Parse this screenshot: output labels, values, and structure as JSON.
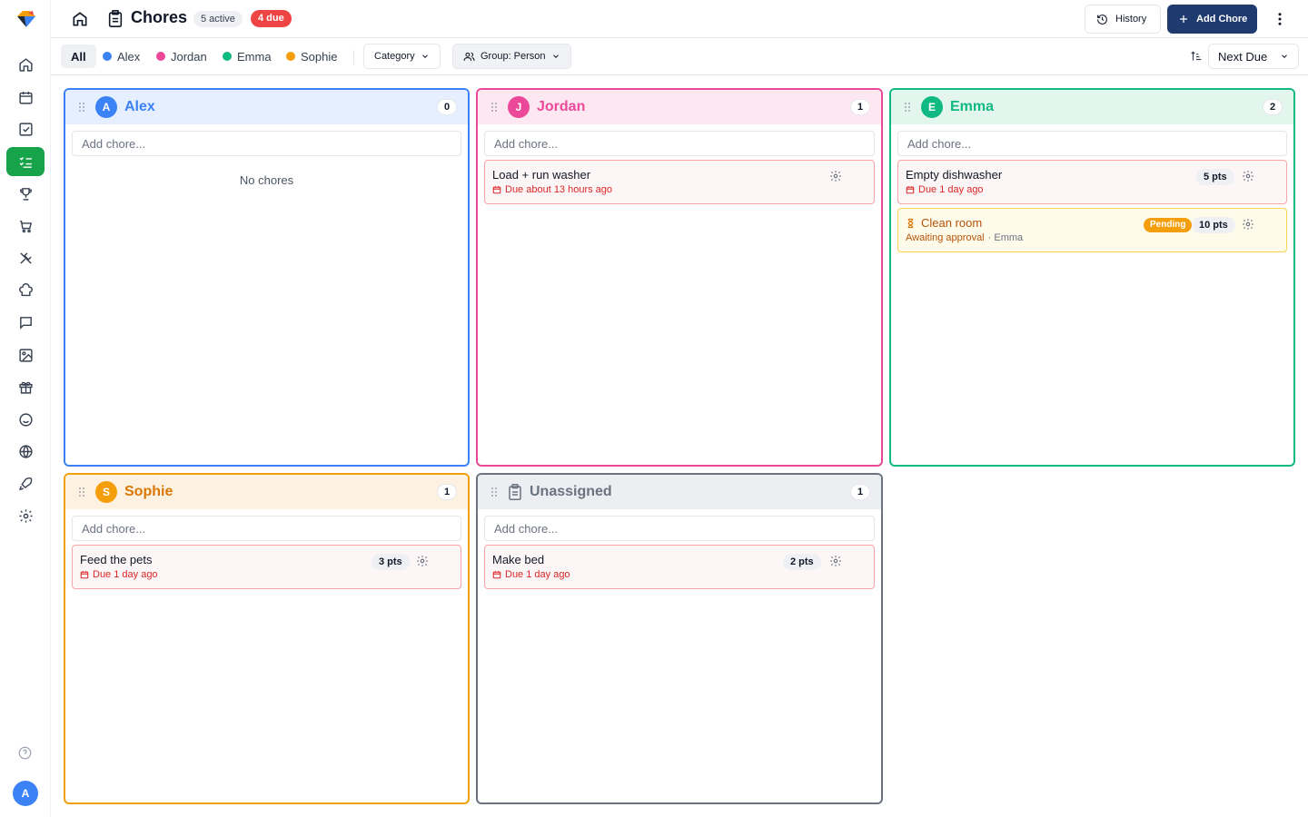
{
  "header": {
    "title": "Chores",
    "active_badge": "5 active",
    "due_badge": "4 due",
    "history_label": "History",
    "add_label": "Add Chore"
  },
  "sidebar": {
    "items": [
      "home",
      "calendar",
      "tasks",
      "chores",
      "trophy",
      "cart",
      "meals",
      "recipes",
      "chat",
      "photos",
      "gifts",
      "smile",
      "globe",
      "rocket",
      "settings"
    ],
    "active": "chores",
    "user_initial": "A"
  },
  "filters": {
    "all_label": "All",
    "people": [
      {
        "name": "Alex",
        "color": "#3b82f6"
      },
      {
        "name": "Jordan",
        "color": "#ec4899"
      },
      {
        "name": "Emma",
        "color": "#10b981"
      },
      {
        "name": "Sophie",
        "color": "#f59e0b"
      }
    ],
    "category_label": "Category",
    "group_label": "Group: Person",
    "sort_label": "Next Due"
  },
  "columns": [
    {
      "name": "Alex",
      "initial": "A",
      "color": "#3b82f6",
      "bg": "#e6efff",
      "count": "0",
      "add_placeholder": "Add chore...",
      "empty_text": "No chores",
      "chores": []
    },
    {
      "name": "Jordan",
      "initial": "J",
      "color": "#ec4899",
      "bg": "#fde8f2",
      "count": "1",
      "add_placeholder": "Add chore...",
      "chores": [
        {
          "title": "Load + run washer",
          "due": "Due about 13 hours ago"
        }
      ]
    },
    {
      "name": "Emma",
      "initial": "E",
      "color": "#10b981",
      "bg": "#e3f6ee",
      "count": "2",
      "add_placeholder": "Add chore...",
      "chores": [
        {
          "title": "Empty dishwasher",
          "due": "Due 1 day ago",
          "points": "5 pts"
        },
        {
          "title": "Clean room",
          "status": "Pending",
          "points": "10 pts",
          "awaiting": "Awaiting approval",
          "by": "· Emma"
        }
      ]
    },
    {
      "name": "Sophie",
      "initial": "S",
      "color": "#f59e0b",
      "bg": "#fdf2e1",
      "count": "1",
      "add_placeholder": "Add chore...",
      "chores": [
        {
          "title": "Feed the pets",
          "due": "Due 1 day ago",
          "points": "3 pts"
        }
      ]
    },
    {
      "name": "Unassigned",
      "color": "#6b7280",
      "bg": "#eceef1",
      "count": "1",
      "add_placeholder": "Add chore...",
      "chores": [
        {
          "title": "Make bed",
          "due": "Due 1 day ago",
          "points": "2 pts"
        }
      ]
    }
  ]
}
